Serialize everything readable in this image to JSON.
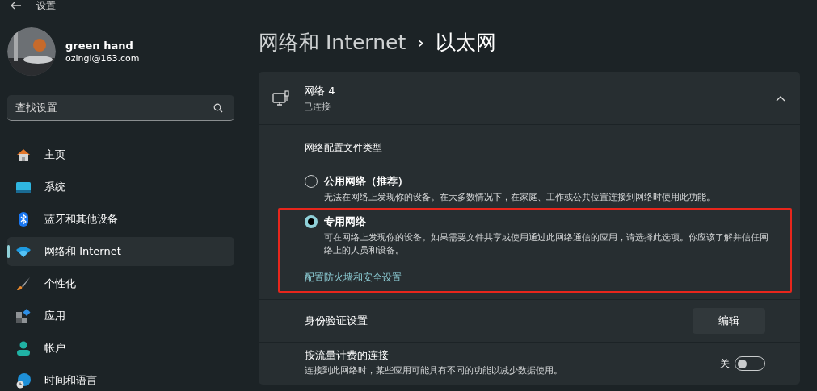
{
  "window": {
    "title": "设置"
  },
  "user": {
    "name": "green hand",
    "email": "ozingi@163.com"
  },
  "search": {
    "placeholder": "查找设置"
  },
  "sidebar": {
    "items": [
      {
        "label": "主页",
        "kind": "home",
        "selected": false
      },
      {
        "label": "系统",
        "kind": "system",
        "selected": false
      },
      {
        "label": "蓝牙和其他设备",
        "kind": "bluetooth",
        "selected": false
      },
      {
        "label": "网络和 Internet",
        "kind": "network",
        "selected": true
      },
      {
        "label": "个性化",
        "kind": "personalize",
        "selected": false
      },
      {
        "label": "应用",
        "kind": "apps",
        "selected": false
      },
      {
        "label": "帐户",
        "kind": "account",
        "selected": false
      },
      {
        "label": "时间和语言",
        "kind": "time",
        "selected": false
      }
    ]
  },
  "breadcrumb": {
    "parent": "网络和 Internet",
    "separator": "›",
    "current": "以太网"
  },
  "network": {
    "name": "网络 4",
    "status": "已连接",
    "expanded": true
  },
  "profile": {
    "heading": "网络配置文件类型",
    "options": [
      {
        "title": "公用网络（推荐）",
        "description": "无法在网络上发现你的设备。在大多数情况下，在家庭、工作或公共位置连接到网络时使用此功能。",
        "selected": false,
        "highlighted": false
      },
      {
        "title": "专用网络",
        "description": "可在网络上发现你的设备。如果需要文件共享或使用通过此网络通信的应用，请选择此选项。你应该了解并信任网络上的人员和设备。",
        "selected": true,
        "highlighted": true
      }
    ],
    "link": "配置防火墙和安全设置"
  },
  "auth": {
    "label": "身份验证设置",
    "button": "编辑"
  },
  "metered": {
    "title": "按流量计费的连接",
    "description": "连接到此网络时，某些应用可能具有不同的功能以减少数据使用。",
    "toggle_label": "关",
    "on": false
  }
}
